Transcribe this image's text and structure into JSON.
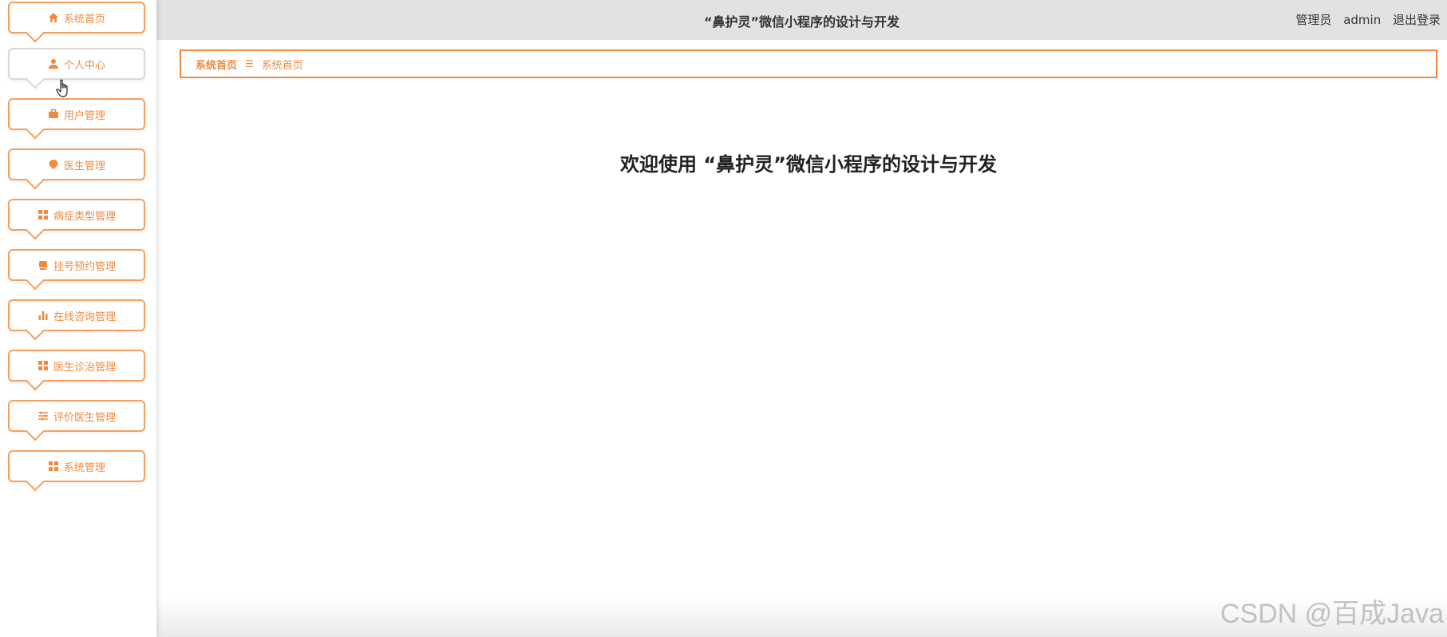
{
  "header": {
    "title": "“鼻护灵”微信小程序的设计与开发",
    "user_role": "管理员",
    "username": "admin",
    "logout_label": "退出登录"
  },
  "sidebar": {
    "items": [
      {
        "label": "系统首页",
        "icon": "home-icon"
      },
      {
        "label": "个人中心",
        "icon": "user-icon"
      },
      {
        "label": "用户管理",
        "icon": "briefcase-icon"
      },
      {
        "label": "医生管理",
        "icon": "pin-icon"
      },
      {
        "label": "病症类型管理",
        "icon": "grid-icon"
      },
      {
        "label": "挂号预约管理",
        "icon": "box-icon"
      },
      {
        "label": "在线咨询管理",
        "icon": "bar-chart-icon"
      },
      {
        "label": "医生诊治管理",
        "icon": "grid-icon"
      },
      {
        "label": "评价医生管理",
        "icon": "sliders-icon"
      },
      {
        "label": "系统管理",
        "icon": "grid-icon"
      }
    ]
  },
  "breadcrumb": {
    "home": "系统首页",
    "separator": "☰",
    "current": "系统首页"
  },
  "main": {
    "welcome": "欢迎使用 “鼻护灵”微信小程序的设计与开发"
  },
  "watermark": "CSDN @百成Java",
  "colors": {
    "accent": "#f08a40",
    "topbar": "#e2e2e2"
  }
}
